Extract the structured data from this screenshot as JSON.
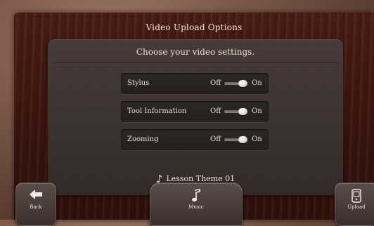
{
  "title": "Video Upload Options",
  "panel": {
    "header": "Choose your video settings.",
    "rows": [
      {
        "label": "Stylus",
        "off_label": "Off",
        "on_label": "On",
        "state": "on"
      },
      {
        "label": "Tool Information",
        "off_label": "Off",
        "on_label": "On",
        "state": "on"
      },
      {
        "label": "Zooming",
        "off_label": "Off",
        "on_label": "On",
        "state": "on"
      }
    ],
    "theme": {
      "icon": "music-note-icon",
      "label": "Lesson Theme 01"
    }
  },
  "buttons": {
    "back": {
      "label": "Back",
      "icon": "back-arrow-icon"
    },
    "music": {
      "label": "Music",
      "icon": "music-note-icon"
    },
    "upload": {
      "label": "Upload",
      "icon": "device-icon"
    }
  }
}
